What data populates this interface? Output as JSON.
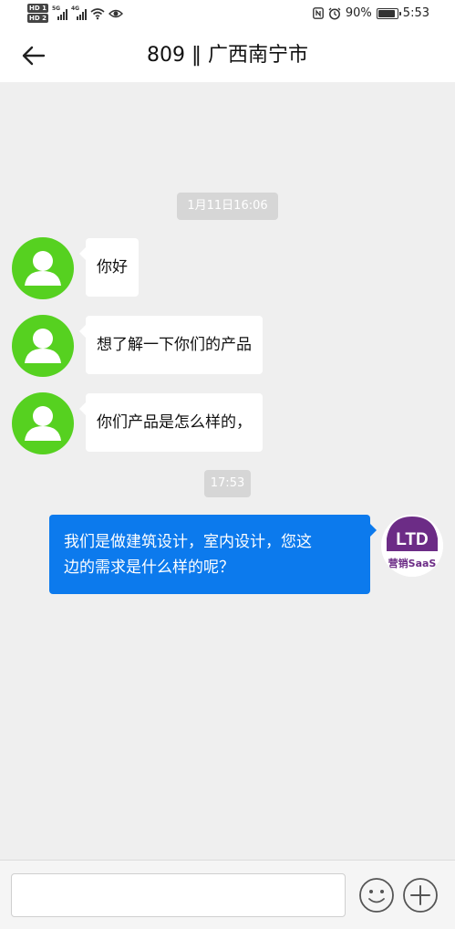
{
  "status_bar": {
    "hd_top": "HD 1",
    "hd_bottom": "HD 2",
    "network_1": "5G",
    "network_2": "4G",
    "battery_percent": "90%",
    "battery_level": 0.9,
    "time": "5:53",
    "icons": [
      "signal-icon",
      "wifi-icon",
      "eye-icon",
      "nfc-icon",
      "alarm-icon",
      "battery-icon"
    ]
  },
  "header": {
    "title": "809 ‖ 广西南宁市",
    "back_icon": "arrow-left-icon"
  },
  "chat": {
    "time_1": "1月11日16:06",
    "incoming": [
      {
        "text": "你好"
      },
      {
        "text": "想了解一下你们的产品"
      },
      {
        "text": "你们产品是怎么样的，"
      }
    ],
    "time_2": "17:53",
    "outgoing": {
      "line_1": "我们是做建筑设计，室内设计，您这",
      "line_2": "边的需求是什么样的呢？"
    },
    "brand_logo": {
      "mark": "LTD",
      "caption": "营销SaaS",
      "color": "#6c2c86"
    }
  },
  "composer": {
    "input_value": "",
    "input_placeholder": "",
    "icons": [
      "emoji-icon",
      "plus-icon"
    ]
  },
  "colors": {
    "accent_blue": "#0c7aed",
    "avatar_green": "#56d120",
    "background": "#efefef"
  }
}
